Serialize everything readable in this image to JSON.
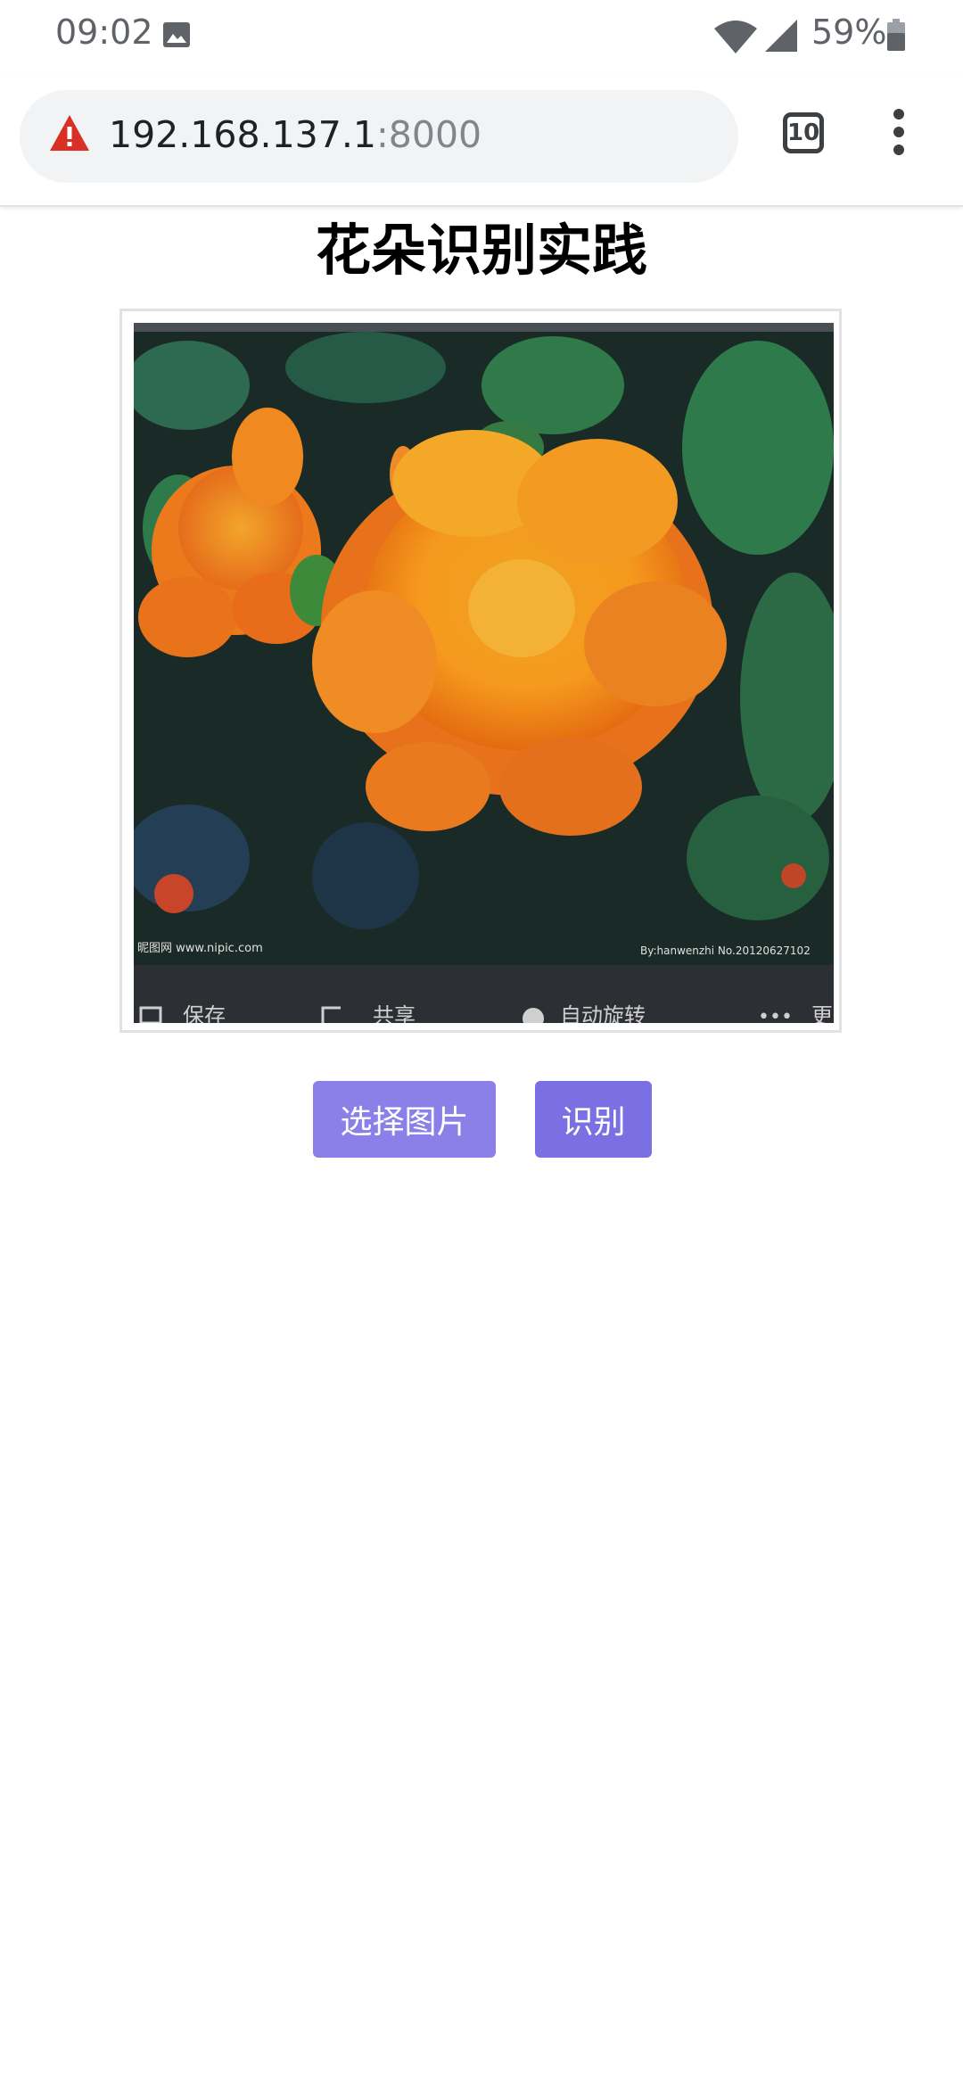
{
  "status_bar": {
    "time": "09:02",
    "battery": "59%",
    "icons": [
      "image-icon",
      "wifi-icon",
      "signal-icon",
      "battery-icon"
    ]
  },
  "browser": {
    "url_host": "192.168.137.1",
    "url_port": ":8000",
    "tab_count": "10",
    "icons": [
      "warning-icon",
      "tabs-icon",
      "more-menu-icon"
    ],
    "warning_color": "#d93025"
  },
  "page": {
    "title": "花朵识别实践",
    "image_watermark_left": "昵图网 www.nipic.com",
    "image_watermark_right": "By:hanwenzhi No.20120627102",
    "image_toolbar": [
      "保存",
      "共享",
      "自动旋转",
      "更"
    ],
    "select_button": "选择图片",
    "recognize_button": "识别",
    "button_color": "#8b80e8"
  }
}
